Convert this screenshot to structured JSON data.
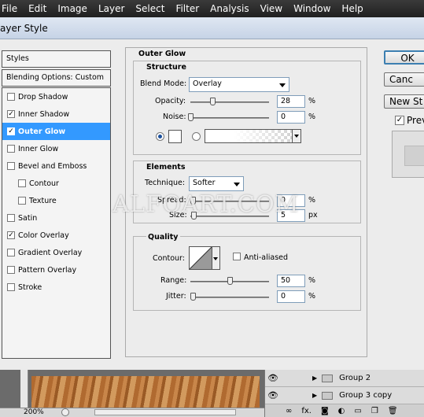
{
  "menubar": {
    "items": [
      "File",
      "Edit",
      "Image",
      "Layer",
      "Select",
      "Filter",
      "Analysis",
      "View",
      "Window",
      "Help"
    ]
  },
  "dialog": {
    "title": "ayer Style",
    "styles_header": "Styles",
    "blending_options": "Blending Options: Custom",
    "styles": [
      {
        "label": "Drop Shadow",
        "checked": false
      },
      {
        "label": "Inner Shadow",
        "checked": true
      },
      {
        "label": "Outer Glow",
        "checked": true,
        "selected": true
      },
      {
        "label": "Inner Glow",
        "checked": false
      },
      {
        "label": "Bevel and Emboss",
        "checked": false
      },
      {
        "label": "Contour",
        "checked": false
      },
      {
        "label": "Texture",
        "checked": false
      },
      {
        "label": "Satin",
        "checked": false
      },
      {
        "label": "Color Overlay",
        "checked": true
      },
      {
        "label": "Gradient Overlay",
        "checked": false
      },
      {
        "label": "Pattern Overlay",
        "checked": false
      },
      {
        "label": "Stroke",
        "checked": false
      }
    ],
    "check_mark": "✓",
    "outer_glow": {
      "title": "Outer Glow",
      "structure": {
        "title": "Structure",
        "blend_mode_label": "Blend Mode:",
        "blend_mode_value": "Overlay",
        "opacity_label": "Opacity:",
        "opacity_value": "28",
        "opacity_level": 0.28,
        "noise_label": "Noise:",
        "noise_value": "0",
        "noise_level": 0,
        "percent": "%"
      },
      "elements": {
        "title": "Elements",
        "technique_label": "Technique:",
        "technique_value": "Softer",
        "spread_label": "Spread:",
        "spread_value": "0",
        "size_label": "Size:",
        "size_value": "5",
        "percent": "%",
        "px": "px"
      },
      "quality": {
        "title": "Quality",
        "contour_label": "Contour:",
        "anti_aliased_label": "Anti-aliased",
        "range_label": "Range:",
        "range_value": "50",
        "range_level": 0.5,
        "jitter_label": "Jitter:",
        "jitter_value": "0",
        "percent": "%"
      }
    },
    "buttons": {
      "ok": "OK",
      "cancel": "Canc",
      "new_style": "New St",
      "preview": "Prev"
    }
  },
  "watermark": "ALFOART.COM",
  "status": {
    "zoom": "200%"
  },
  "layers": {
    "rows": [
      "Group 2",
      "Group 3 copy"
    ],
    "footer_icons": [
      "link-icon",
      "fx-icon",
      "mask-icon",
      "adjustment-icon",
      "folder-icon",
      "new-layer-icon",
      "trash-icon"
    ],
    "fx_label": "fx."
  },
  "colors": {
    "selection": "#3399ff",
    "menubar": "#2a2a2a"
  }
}
